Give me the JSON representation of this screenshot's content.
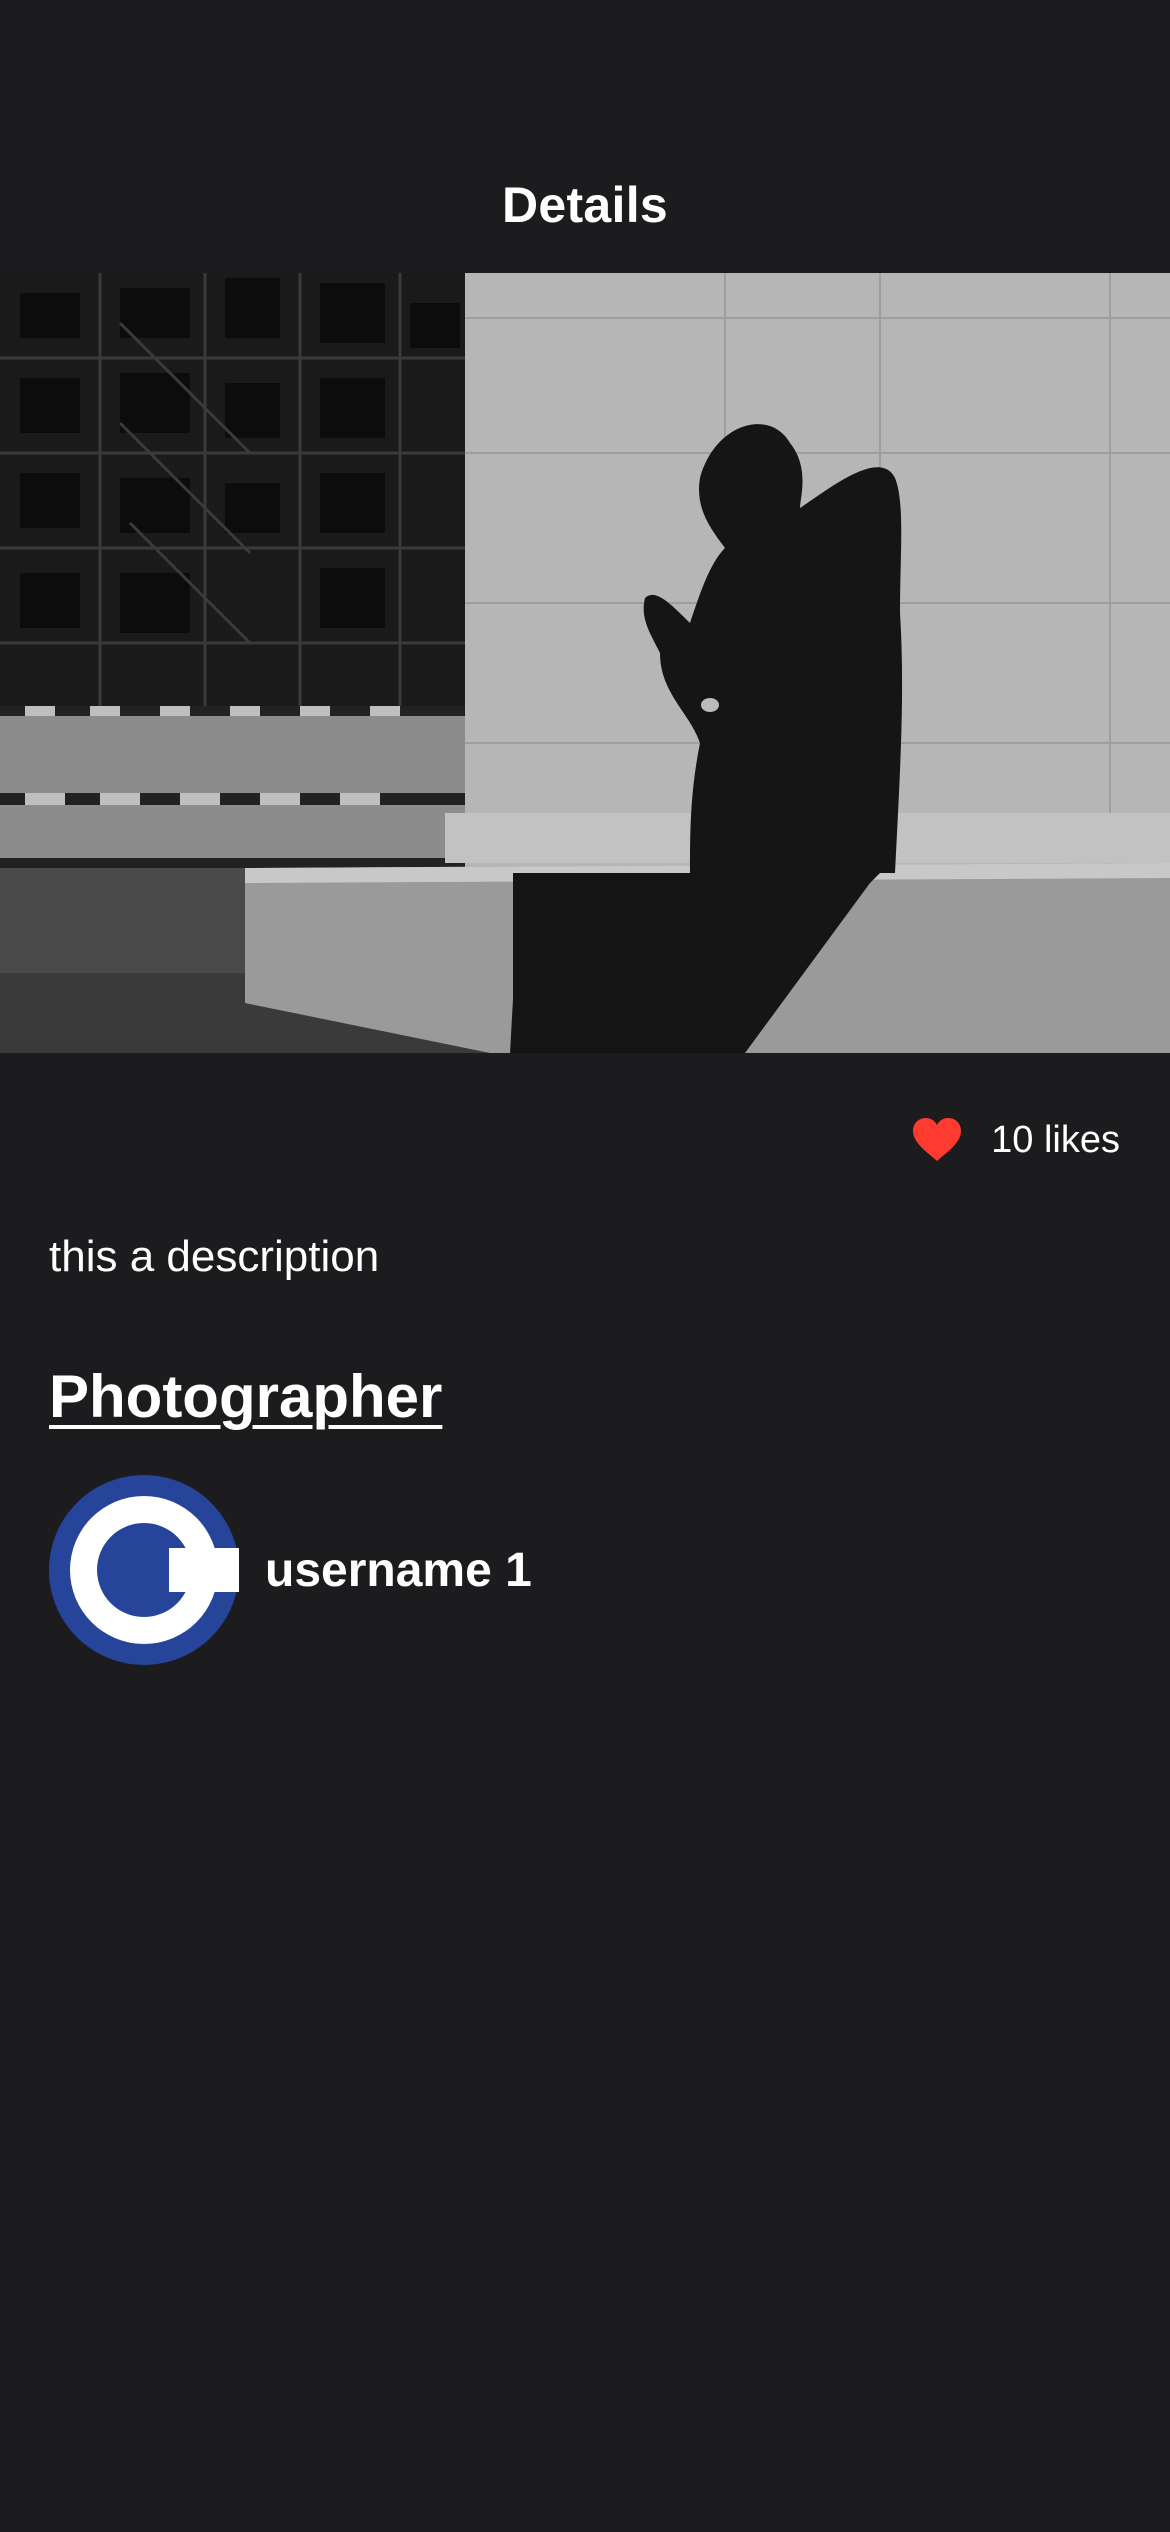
{
  "nav": {
    "title": "Details"
  },
  "photo": {
    "zoom_icon": "zoom-in-icon"
  },
  "likes": {
    "icon": "heart-icon",
    "icon_color": "#ff3b30",
    "text": "10 likes"
  },
  "description": "this a description",
  "photographer": {
    "section_title": "Photographer",
    "avatar_icon": "c-logo-avatar",
    "avatar_color": "#25449a",
    "username": "username 1"
  },
  "colors": {
    "background": "#1c1c1e",
    "text": "#ffffff"
  }
}
